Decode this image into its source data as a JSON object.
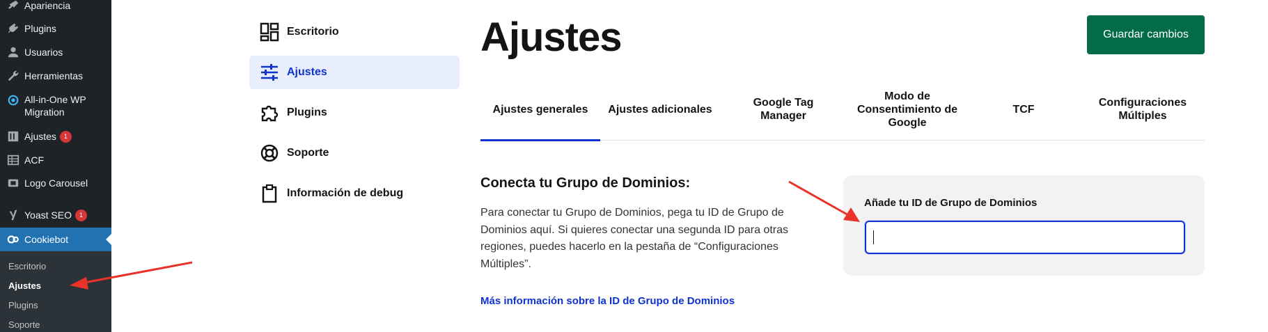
{
  "wp_menu": {
    "items": [
      {
        "label": "Apariencia",
        "icon": "paintbrush-icon"
      },
      {
        "label": "Plugins",
        "icon": "plug-icon"
      },
      {
        "label": "Usuarios",
        "icon": "user-icon"
      },
      {
        "label": "Herramientas",
        "icon": "wrench-icon"
      },
      {
        "label": "All-in-One WP",
        "label2": "Migration",
        "icon": "migration-icon"
      },
      {
        "label": "Ajustes",
        "icon": "settings-icon",
        "badge": "1"
      },
      {
        "label": "ACF",
        "icon": "table-icon"
      },
      {
        "label": "Logo Carousel",
        "icon": "carousel-icon"
      },
      {
        "label": "Yoast SEO",
        "icon": "yoast-icon",
        "badge": "1"
      },
      {
        "label": "Cookiebot",
        "icon": "cookiebot-icon"
      }
    ],
    "submenu": [
      "Escritorio",
      "Ajustes",
      "Plugins",
      "Soporte"
    ],
    "submenu_current": "Ajustes"
  },
  "plugin_nav": {
    "items": [
      {
        "label": "Escritorio",
        "icon": "dashboard-icon"
      },
      {
        "label": "Ajustes",
        "icon": "sliders-icon"
      },
      {
        "label": "Plugins",
        "icon": "puzzle-icon"
      },
      {
        "label": "Soporte",
        "icon": "lifebuoy-icon"
      },
      {
        "label": "Información de debug",
        "icon": "clipboard-icon"
      }
    ],
    "active": "Ajustes"
  },
  "page": {
    "title": "Ajustes",
    "save_label": "Guardar cambios"
  },
  "tabs": [
    {
      "label": "Ajustes generales",
      "active": true
    },
    {
      "label": "Ajustes adicionales"
    },
    {
      "label": "Google Tag Manager"
    },
    {
      "label": "Modo de Consentimiento de Google"
    },
    {
      "label": "TCF"
    },
    {
      "label": "Configuraciones Múltiples"
    }
  ],
  "section": {
    "title": "Conecta tu Grupo de Dominios:",
    "description": "Para conectar tu Grupo de Dominios, pega tu ID de Grupo de Dominios aquí. Si quieres conectar una segunda ID para otras regiones, puedes hacerlo en la pestaña de “Configuraciones Múltiples”.",
    "link": "Más información sobre la ID de Grupo de Dominios",
    "field_label": "Añade tu ID de Grupo de Dominios",
    "field_value": ""
  },
  "colors": {
    "wp_sidebar": "#1d2327",
    "wp_active": "#2271b1",
    "accent_blue": "#1032cf",
    "save_green": "#036c47",
    "annotation_red": "#e8322a"
  }
}
